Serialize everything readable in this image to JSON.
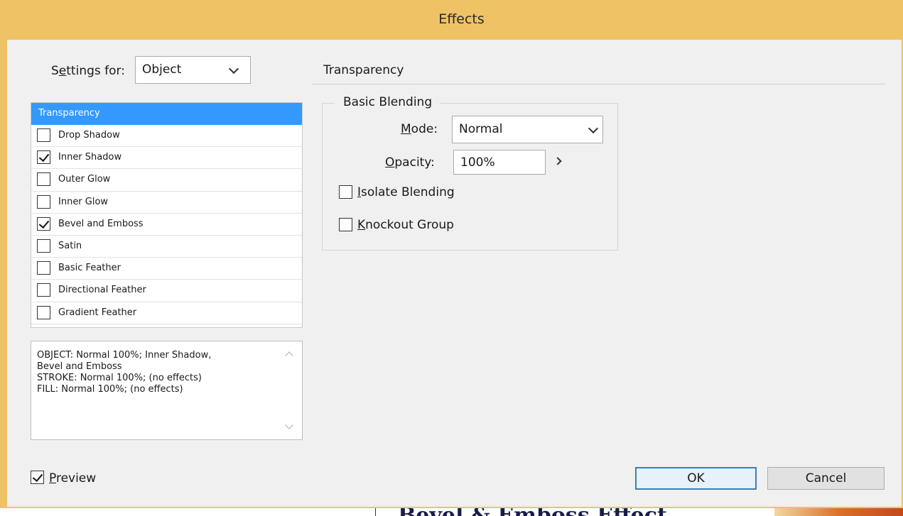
{
  "dialog": {
    "title": "Effects"
  },
  "settings_for": {
    "label_prefix": "S",
    "label_underlined": "e",
    "label_suffix": "ttings for:",
    "value": "Object"
  },
  "effects_list": {
    "selected": "Transparency",
    "items": [
      {
        "label": "Drop Shadow",
        "checked": false
      },
      {
        "label": "Inner Shadow",
        "checked": true
      },
      {
        "label": "Outer Glow",
        "checked": false
      },
      {
        "label": "Inner Glow",
        "checked": false
      },
      {
        "label": "Bevel and Emboss",
        "checked": true
      },
      {
        "label": "Satin",
        "checked": false
      },
      {
        "label": "Basic Feather",
        "checked": false
      },
      {
        "label": "Directional Feather",
        "checked": false
      },
      {
        "label": "Gradient Feather",
        "checked": false
      }
    ]
  },
  "summary": {
    "lines": [
      "OBJECT: Normal 100%; Inner Shadow,",
      "Bevel and Emboss",
      "STROKE: Normal 100%; (no effects)",
      "FILL: Normal 100%; (no effects)"
    ]
  },
  "transparency": {
    "section_title": "Transparency",
    "group_title": "Basic Blending",
    "mode_label_underlined": "M",
    "mode_label_rest": "ode:",
    "mode_value": "Normal",
    "opacity_label_underlined": "O",
    "opacity_label_rest": "pacity:",
    "opacity_value": "100%",
    "isolate_underlined": "I",
    "isolate_rest": "solate Blending",
    "isolate_checked": false,
    "knockout_underlined": "K",
    "knockout_rest": "nockout Group",
    "knockout_checked": false
  },
  "footer": {
    "preview_underlined": "P",
    "preview_rest": "review",
    "preview_checked": true,
    "ok_label": "OK",
    "cancel_label": "Cancel"
  },
  "background_doc": {
    "text": "Bevel & Emboss Effect"
  }
}
